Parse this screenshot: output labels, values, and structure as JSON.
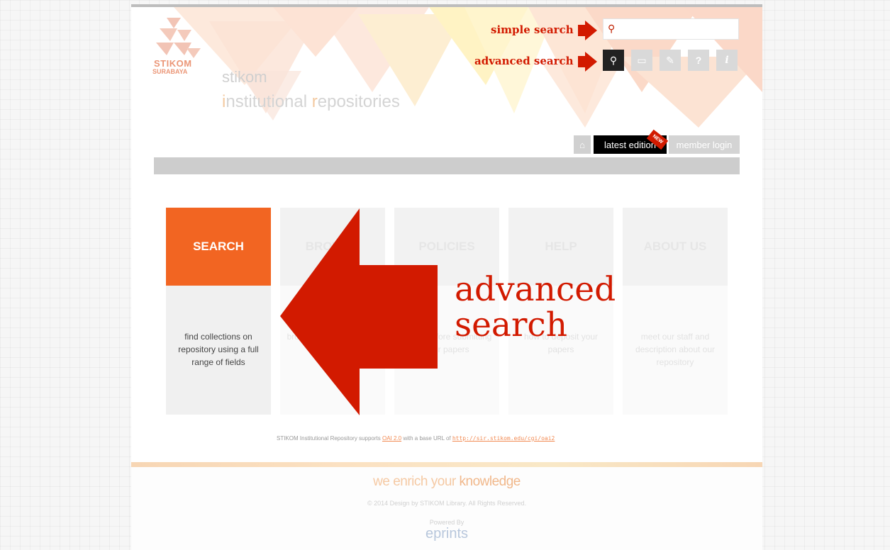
{
  "header": {
    "logo_line1": "STIKOM",
    "logo_line2": "SURABAYA",
    "site_name_line1": "stikom",
    "site_name_line2": "institutional repositories"
  },
  "annotations": {
    "simple_search": "simple search",
    "advanced_search": "advanced search",
    "big_label": "advanced search"
  },
  "search": {
    "placeholder": "",
    "value": ""
  },
  "toolbar_icons": [
    "advanced-search-icon",
    "folder-icon",
    "pencil-icon",
    "question-icon",
    "info-icon"
  ],
  "nav": {
    "home_icon": "home-icon",
    "latest": "latest edition",
    "latest_badge": "NEW",
    "member": "member login"
  },
  "cards": [
    {
      "title": "SEARCH",
      "desc": "find collections on repository using a full range of fields",
      "active": true
    },
    {
      "title": "BROWSE",
      "desc": "browse our collection by division",
      "active": false
    },
    {
      "title": "POLICIES",
      "desc": "check before submitting your papers",
      "active": false
    },
    {
      "title": "HELP",
      "desc": "how to deposit your papers",
      "active": false
    },
    {
      "title": "ABOUT US",
      "desc": "meet our staff and description about our repository",
      "active": false
    }
  ],
  "oai": {
    "prefix": "STIKOM Institutional Repository supports",
    "link": "OAI 2.0",
    "middle": "with a base URL of",
    "url": "http://sir.stikom.edu/cgi/oai2"
  },
  "footer": {
    "tagline_light": "we enrich your",
    "tagline_bold": "knowledge",
    "copyright": "© 2014 Design by STIKOM Library. All Rights Reserved.",
    "powered_by": "Powered By",
    "powered_logo": "eprints"
  },
  "colors": {
    "accent": "#f26522",
    "annotation": "#d21a00",
    "dark": "#222222"
  }
}
